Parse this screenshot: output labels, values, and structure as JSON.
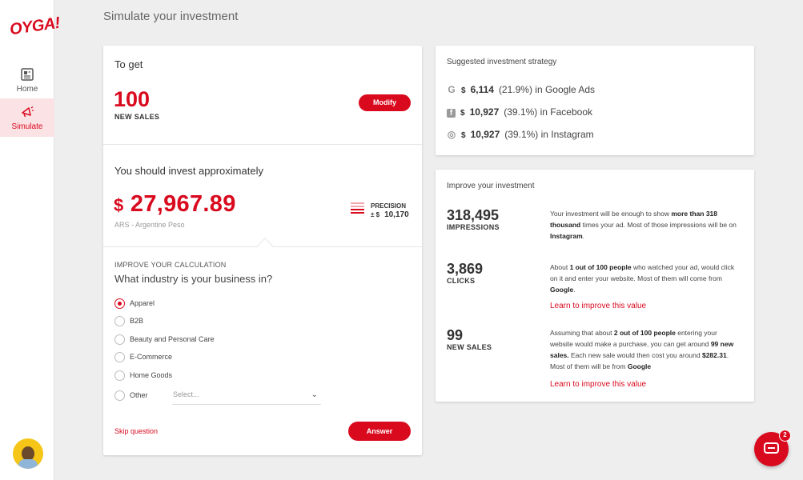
{
  "sidebar": {
    "logo": "OYGA!",
    "items": [
      {
        "label": "Home",
        "icon": "newspaper-icon"
      },
      {
        "label": "Simulate",
        "icon": "megaphone-icon",
        "active": true
      }
    ]
  },
  "page_title": "Simulate your investment",
  "goal": {
    "heading": "To get",
    "value": "100",
    "unit": "NEW SALES",
    "modify_label": "Modify"
  },
  "investment": {
    "heading": "You should invest approximately",
    "currency_symbol": "$",
    "amount": "27,967.89",
    "currency_name": "ARS - Argentine Peso",
    "precision_label": "PRECISION",
    "precision_pm": "± $",
    "precision_value": "10,170"
  },
  "question": {
    "section_label": "IMPROVE YOUR CALCULATION",
    "text": "What industry is your business in?",
    "options": [
      "Apparel",
      "B2B",
      "Beauty and Personal Care",
      "E-Commerce",
      "Home Goods",
      "Other"
    ],
    "selected": "Apparel",
    "select_placeholder": "Select...",
    "skip_label": "Skip question",
    "answer_label": "Answer"
  },
  "strategy": {
    "heading": "Suggested investment strategy",
    "rows": [
      {
        "icon": "google-icon",
        "icon_glyph": "G",
        "currency": "$",
        "value": "6,114",
        "detail": "(21.9%) in Google Ads"
      },
      {
        "icon": "facebook-icon",
        "icon_glyph": "f",
        "currency": "$",
        "value": "10,927",
        "detail": "(39.1%) in Facebook"
      },
      {
        "icon": "instagram-icon",
        "icon_glyph": "◎",
        "currency": "$",
        "value": "10,927",
        "detail": "(39.1%) in Instagram"
      }
    ]
  },
  "improve": {
    "heading": "Improve your investment",
    "metrics": [
      {
        "value": "318,495",
        "label": "IMPRESSIONS",
        "desc_parts": [
          "Your investment will be enough to show ",
          "more than 318 thousand",
          " times your ad. Most of those impressions will be on ",
          "Instagram",
          "."
        ]
      },
      {
        "value": "3,869",
        "label": "CLICKS",
        "desc_parts": [
          "About ",
          "1 out of 100 people",
          " who watched your ad, would click on it and enter your website. Most of them will come from ",
          "Google",
          "."
        ],
        "link": "Learn to improve this value"
      },
      {
        "value": "99",
        "label": "NEW SALES",
        "desc_parts": [
          "Assuming that about ",
          "2 out of 100 people",
          " entering your website would make a purchase, you can get around ",
          "99 new sales.",
          " Each new sale would then cost you around ",
          "$282.31",
          ". Most of them will be from ",
          "Google"
        ],
        "link": "Learn to improve this value"
      }
    ]
  },
  "chat": {
    "badge": "2"
  },
  "colors": {
    "accent": "#d9091e",
    "background": "#eeeeee"
  }
}
